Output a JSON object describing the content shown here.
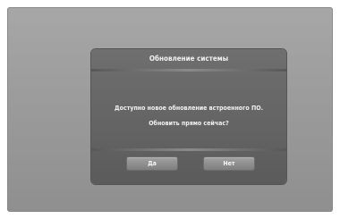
{
  "dialog": {
    "title": "Обновление системы",
    "message_line1": "Доступно новое обновление встроенного ПО.",
    "message_line2": "Обновить прямо сейчас?",
    "yes_label": "Да",
    "no_label": "Нет"
  },
  "colors": {
    "screen_bg": "#9c9c9c",
    "dialog_bg": "#666666",
    "button_bg": "#8f8f8f",
    "text": "#f2f2f2"
  }
}
